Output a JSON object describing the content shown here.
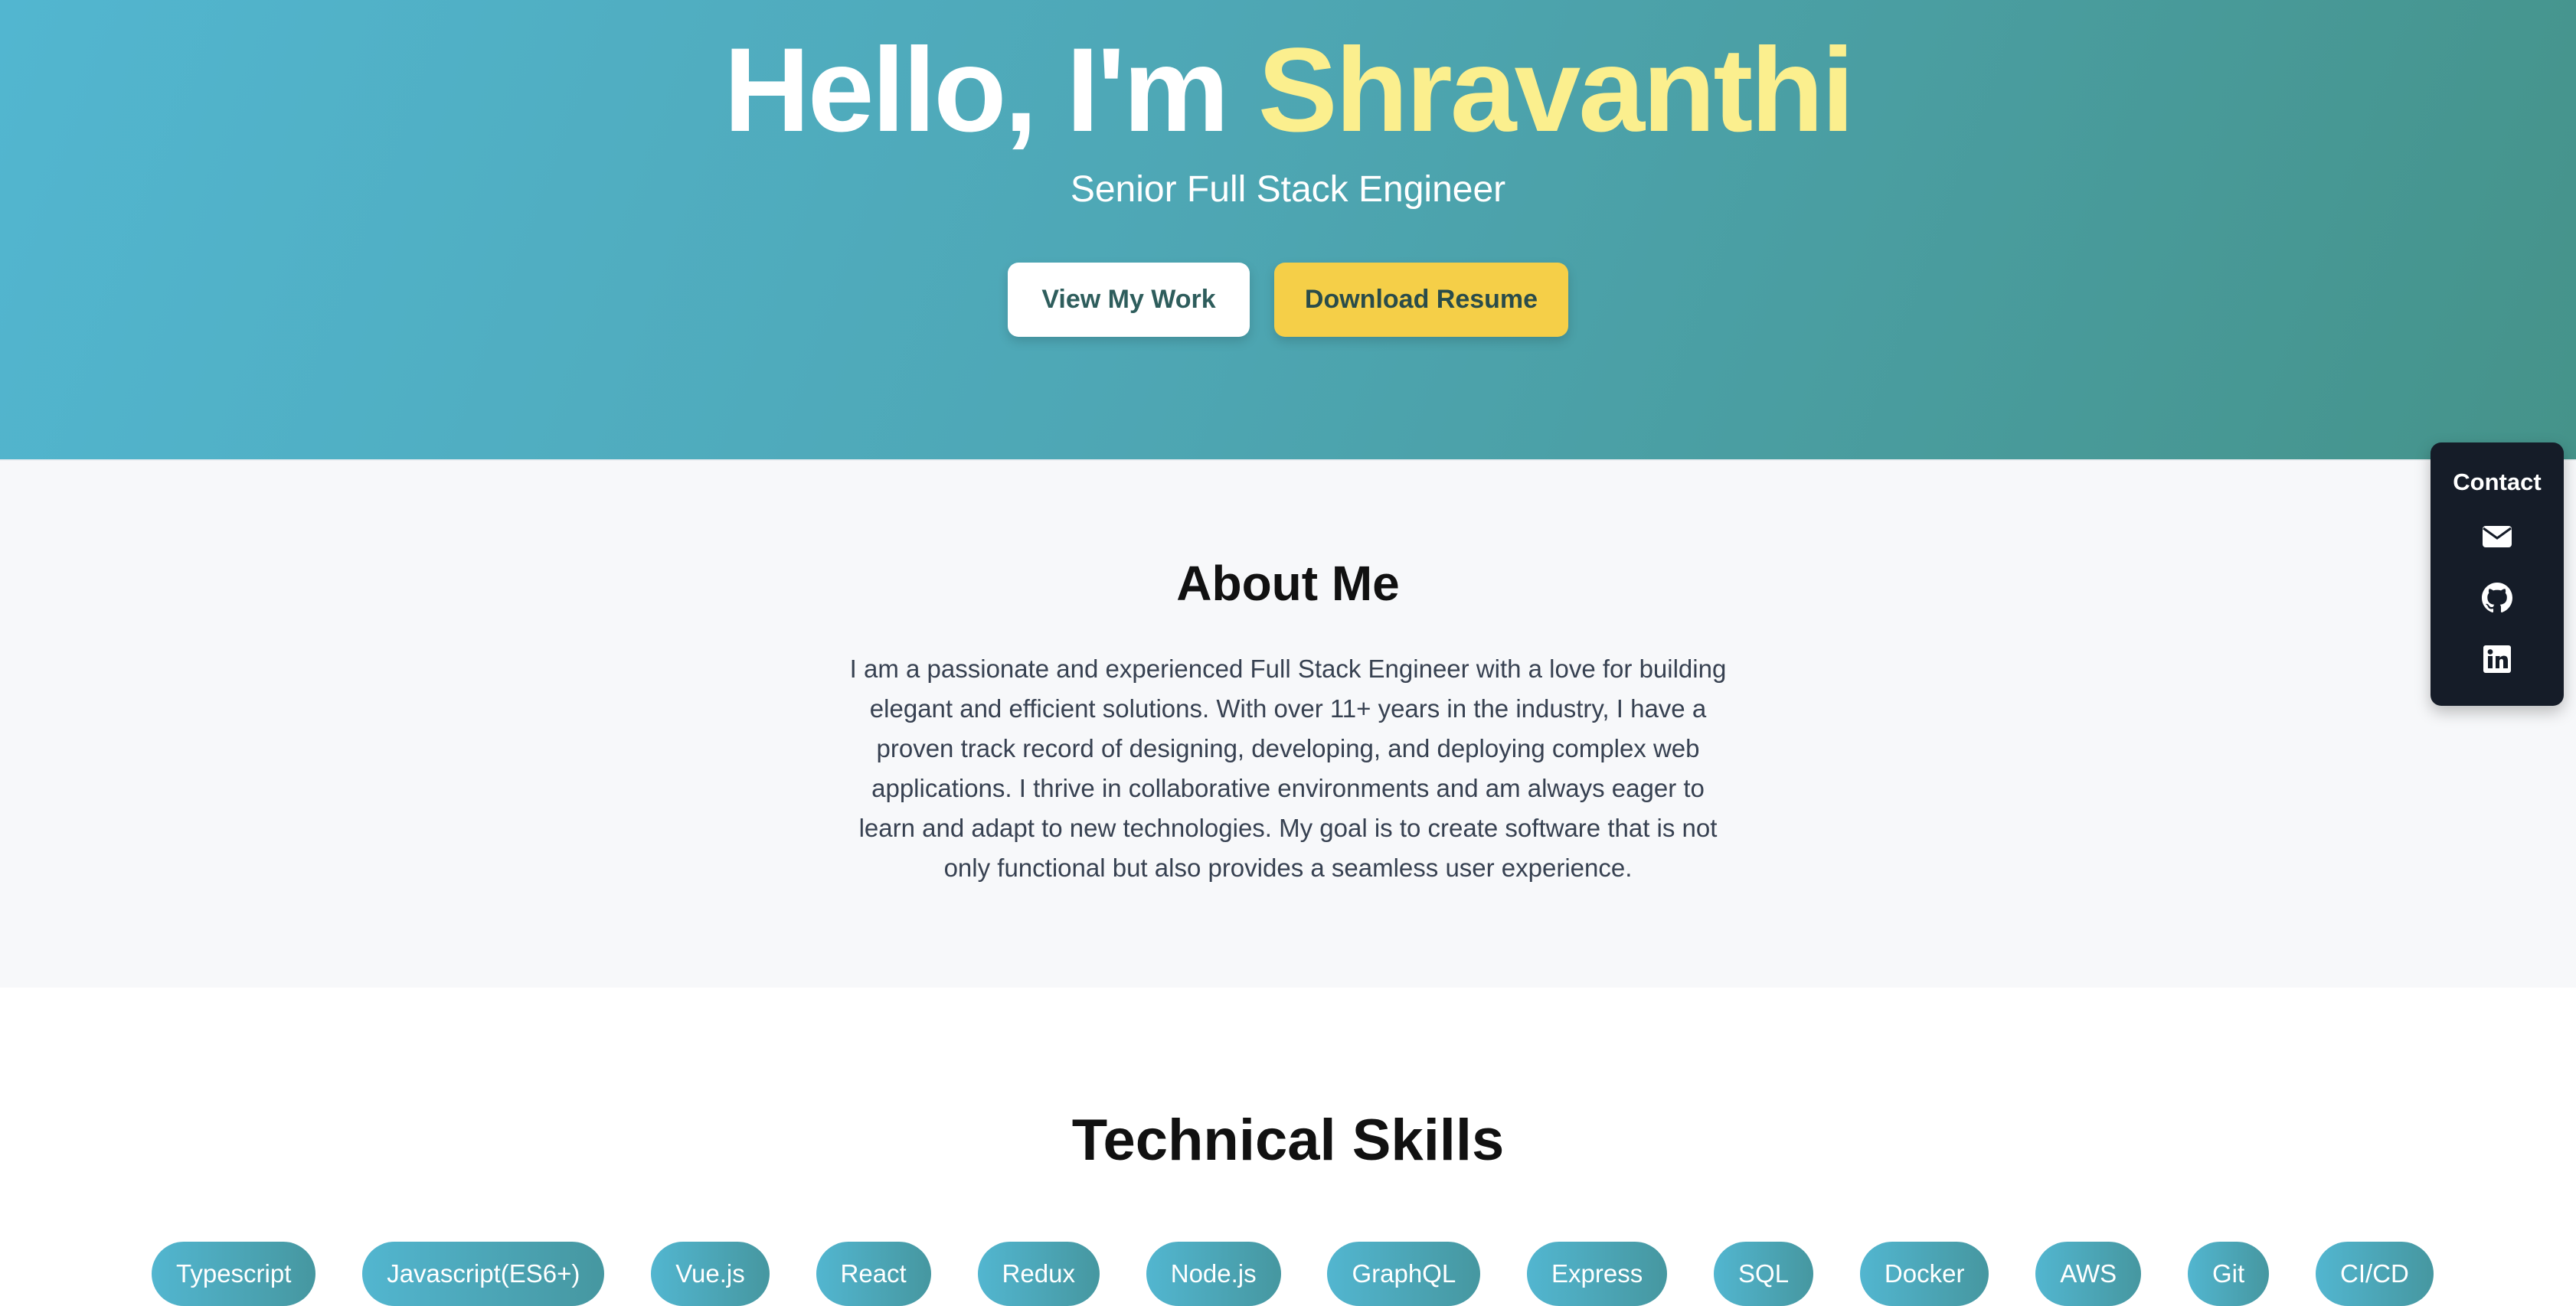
{
  "hero": {
    "greeting": "Hello, I'm ",
    "name": "Shravanthi",
    "subtitle": "Senior Full Stack Engineer",
    "primary_button": "View My Work",
    "secondary_button": "Download Resume"
  },
  "about": {
    "title": "About Me",
    "text": "I am a passionate and experienced Full Stack Engineer with a love for building elegant and efficient solutions. With over 11+ years in the industry, I have a proven track record of designing, developing, and deploying complex web applications. I thrive in collaborative environments and am always eager to learn and adapt to new technologies. My goal is to create software that is not only functional but also provides a seamless user experience."
  },
  "skills": {
    "title": "Technical Skills",
    "items": [
      "Typescript",
      "Javascript(ES6+)",
      "Vue.js",
      "React",
      "Redux",
      "Node.js",
      "GraphQL",
      "Express",
      "SQL",
      "Docker",
      "AWS",
      "Git",
      "CI/CD"
    ]
  },
  "contact": {
    "title": "Contact",
    "icons": [
      "envelope-icon",
      "github-icon",
      "linkedin-icon"
    ]
  },
  "colors": {
    "hero_gradient_start": "#52b6d0",
    "hero_gradient_end": "#45938a",
    "name_accent": "#fbef8e",
    "resume_button": "#f5cf48",
    "contact_panel": "#151c28"
  }
}
